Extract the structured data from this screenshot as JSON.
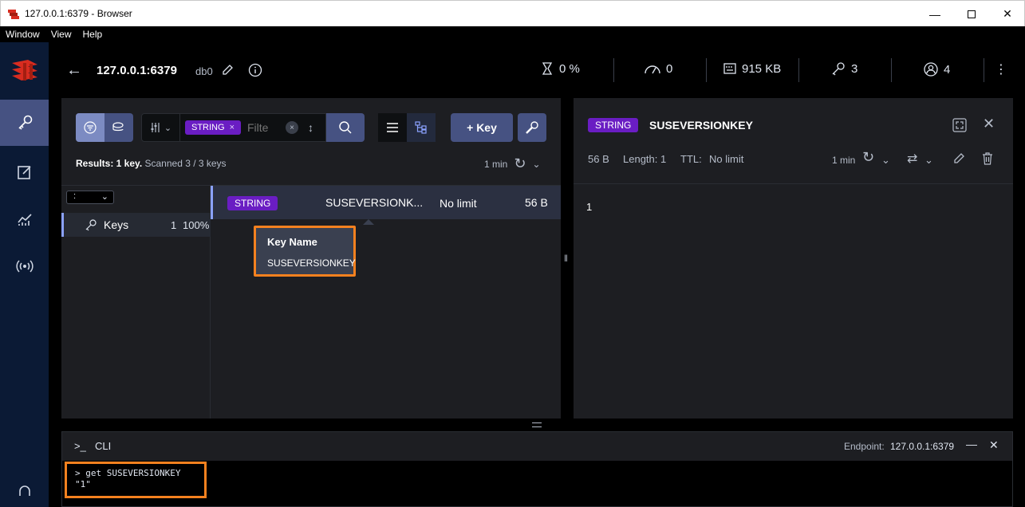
{
  "window": {
    "title": "127.0.0.1:6379 - Browser"
  },
  "menu": [
    "Window",
    "View",
    "Help"
  ],
  "header": {
    "host": "127.0.0.1:6379",
    "db": "db0",
    "stats": [
      {
        "icon": "cpu-icon",
        "value": "0 %"
      },
      {
        "icon": "gauge-icon",
        "value": "0"
      },
      {
        "icon": "memory-icon",
        "value": "915 KB"
      },
      {
        "icon": "key-icon",
        "value": "3"
      },
      {
        "icon": "user-icon",
        "value": "4"
      }
    ]
  },
  "browser": {
    "filter_type": "STRING",
    "filter_placeholder": "Filte",
    "add_key_label": "+ Key",
    "results_bold": "Results: 1 key.",
    "results_rest": " Scanned 3 / 3 keys",
    "refresh_label": "1 min",
    "delimiter": ":",
    "tree": {
      "label": "Keys",
      "count": "1",
      "percent": "100%"
    },
    "keys": [
      {
        "type": "STRING",
        "name": "SUSEVERSIONK...",
        "ttl": "No limit",
        "size": "56 B"
      }
    ],
    "tooltip": {
      "title": "Key Name",
      "value": "SUSEVERSIONKEY"
    }
  },
  "detail": {
    "type": "STRING",
    "key_name": "SUSEVERSIONKEY",
    "size": "56 B",
    "length": "Length: 1",
    "ttl_label": "TTL:",
    "ttl_value": "No limit",
    "refresh_label": "1 min",
    "value": "1"
  },
  "cli": {
    "title": "CLI",
    "endpoint_label": "Endpoint:",
    "endpoint": "127.0.0.1:6379",
    "command": "> get SUSEVERSIONKEY",
    "output": "\"1\""
  },
  "colors": {
    "accent": "#465282",
    "string_tag": "#6a1dc3",
    "highlight": "#f5811f"
  }
}
